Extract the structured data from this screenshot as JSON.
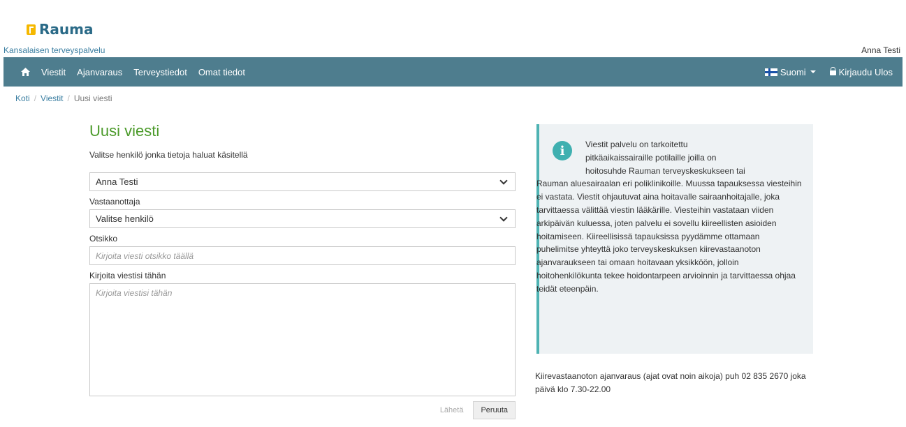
{
  "header": {
    "logo_text": "Rauma",
    "service_name": "Kansalaisen terveyspalvelu",
    "user_name": "Anna Testi"
  },
  "nav": {
    "items": [
      "Viestit",
      "Ajanvaraus",
      "Terveystiedot",
      "Omat tiedot"
    ],
    "language": "Suomi",
    "logout": "Kirjaudu Ulos"
  },
  "breadcrumb": {
    "home": "Koti",
    "messages": "Viestit",
    "current": "Uusi viesti"
  },
  "form": {
    "title": "Uusi viesti",
    "person_label": "Valitse henkilö jonka tietoja haluat käsitellä",
    "person_value": "Anna Testi",
    "recipient_label": "Vastaanottaja",
    "recipient_value": "Valitse henkilö",
    "subject_label": "Otsikko",
    "subject_placeholder": "Kirjoita viesti otsikko täällä",
    "message_label": "Kirjoita viestisi tähän",
    "message_placeholder": "Kirjoita viestisi tähän",
    "send_label": "Lähetä",
    "cancel_label": "Peruuta"
  },
  "info": {
    "line1": "Viestit palvelu on tarkoitettu",
    "line2": "pitkäaikaissairaille potilaille joilla on",
    "line3": "hoitosuhde Rauman terveyskeskukseen tai",
    "rest": "Rauman aluesairaalan eri poliklinikoille. Muussa tapauksessa viesteihin ei vastata. Viestit ohjautuvat aina hoitavalle sairaanhoitajalle, joka tarvittaessa välittää viestin lääkärille. Viesteihin vastataan viiden arkipäivän kuluessa, joten palvelu ei sovellu kiireellisten asioiden hoitamiseen. Kiireellisissä tapauksissa pyydämme ottamaan puhelimitse yhteyttä joko terveyskeskuksen kiirevastaanoton ajanvaraukseen tai omaan hoitavaan yksikköön, jolloin hoitohenkilökunta tekee hoidontarpeen arvioinnin ja tarvittaessa ohjaa teidät eteenpäin."
  },
  "emergency_text": "Kiirevastaanoton ajanvaraus (ajat ovat noin aikoja) puh 02 835 2670 joka päivä klo 7.30-22.00",
  "colors": {
    "navbar": "#4e7d8e",
    "title_green": "#4b9a2a",
    "info_accent": "#3fb0b0",
    "link": "#3a7ea1"
  }
}
